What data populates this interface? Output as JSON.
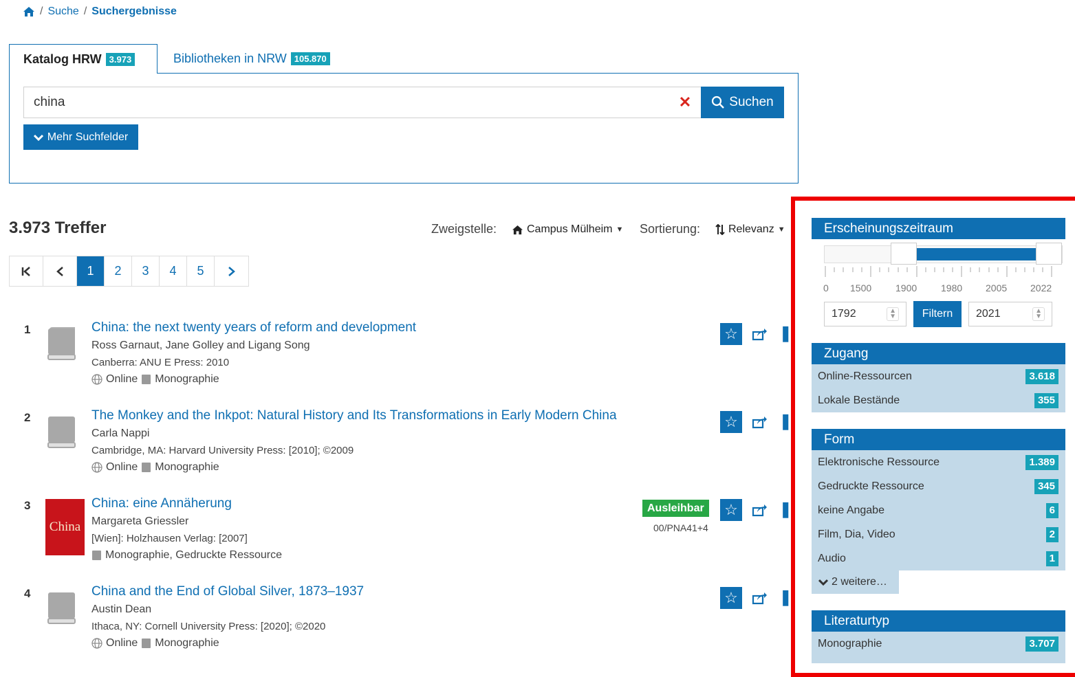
{
  "breadcrumb": {
    "home_icon": "home-icon",
    "items": [
      "Suche",
      "Suchergebnisse"
    ]
  },
  "tabs": [
    {
      "label": "Katalog HRW",
      "count": "3.973",
      "active": true
    },
    {
      "label": "Bibliotheken in NRW",
      "count": "105.870",
      "active": false
    }
  ],
  "search": {
    "value": "china",
    "clear_label": "✕",
    "submit_label": "Suchen",
    "more_fields_label": "Mehr Suchfelder"
  },
  "results_header": {
    "hits": "3.973 Treffer",
    "branch_label": "Zweigstelle:",
    "branch_value": "Campus Mülheim",
    "sort_label": "Sortierung:",
    "sort_value": "Relevanz"
  },
  "pagination": {
    "pages": [
      "1",
      "2",
      "3",
      "4",
      "5"
    ],
    "current": "1"
  },
  "results": [
    {
      "num": "1",
      "title": "China: the next twenty years of reform and development",
      "author": "Ross Garnaut, Jane Golley and Ligang Song",
      "publisher": "Canberra: ANU E Press: 2010",
      "online": "Online",
      "type": "Monographie"
    },
    {
      "num": "2",
      "title": "The Monkey and the Inkpot: Natural History and Its Transformations in Early Modern China",
      "author": "Carla Nappi",
      "publisher": "Cambridge, MA: Harvard University Press: [2010]; ©2009",
      "online": "Online",
      "type": "Monographie"
    },
    {
      "num": "3",
      "title": "China: eine Annäherung",
      "author": "Margareta Griessler",
      "publisher": "[Wien]: Holzhausen Verlag: [2007]",
      "type": "Monographie, Gedruckte Ressource",
      "cover_text": "China",
      "status": "Ausleihbar",
      "signature": "00/PNA41+4"
    },
    {
      "num": "4",
      "title": "China and the End of Global Silver, 1873–1937",
      "author": "Austin Dean",
      "publisher": "Ithaca, NY: Cornell University Press: [2020]; ©2020",
      "online": "Online",
      "type": "Monographie"
    }
  ],
  "sidebar": {
    "period": {
      "title": "Erscheinungszeitraum",
      "tick_labels": [
        "0",
        "1500",
        "1900",
        "1980",
        "2005",
        "2022"
      ],
      "from": "1792",
      "to": "2021",
      "filter_label": "Filtern"
    },
    "access": {
      "title": "Zugang",
      "items": [
        {
          "label": "Online-Ressourcen",
          "count": "3.618"
        },
        {
          "label": "Lokale Bestände",
          "count": "355"
        }
      ]
    },
    "form": {
      "title": "Form",
      "items": [
        {
          "label": "Elektronische Ressource",
          "count": "1.389"
        },
        {
          "label": "Gedruckte Ressource",
          "count": "345"
        },
        {
          "label": "keine Angabe",
          "count": "6"
        },
        {
          "label": "Film, Dia, Video",
          "count": "2"
        },
        {
          "label": "Audio",
          "count": "1"
        }
      ],
      "more_label": "2 weitere…"
    },
    "literature": {
      "title": "Literaturtyp",
      "items": [
        {
          "label": "Monographie",
          "count": "3.707"
        }
      ]
    }
  },
  "colors": {
    "primary": "#0f6fb2",
    "count_badge": "#17a2b8",
    "available": "#28a745",
    "facet_bg": "#c2d9e8",
    "highlight_frame": "#ee0000"
  }
}
